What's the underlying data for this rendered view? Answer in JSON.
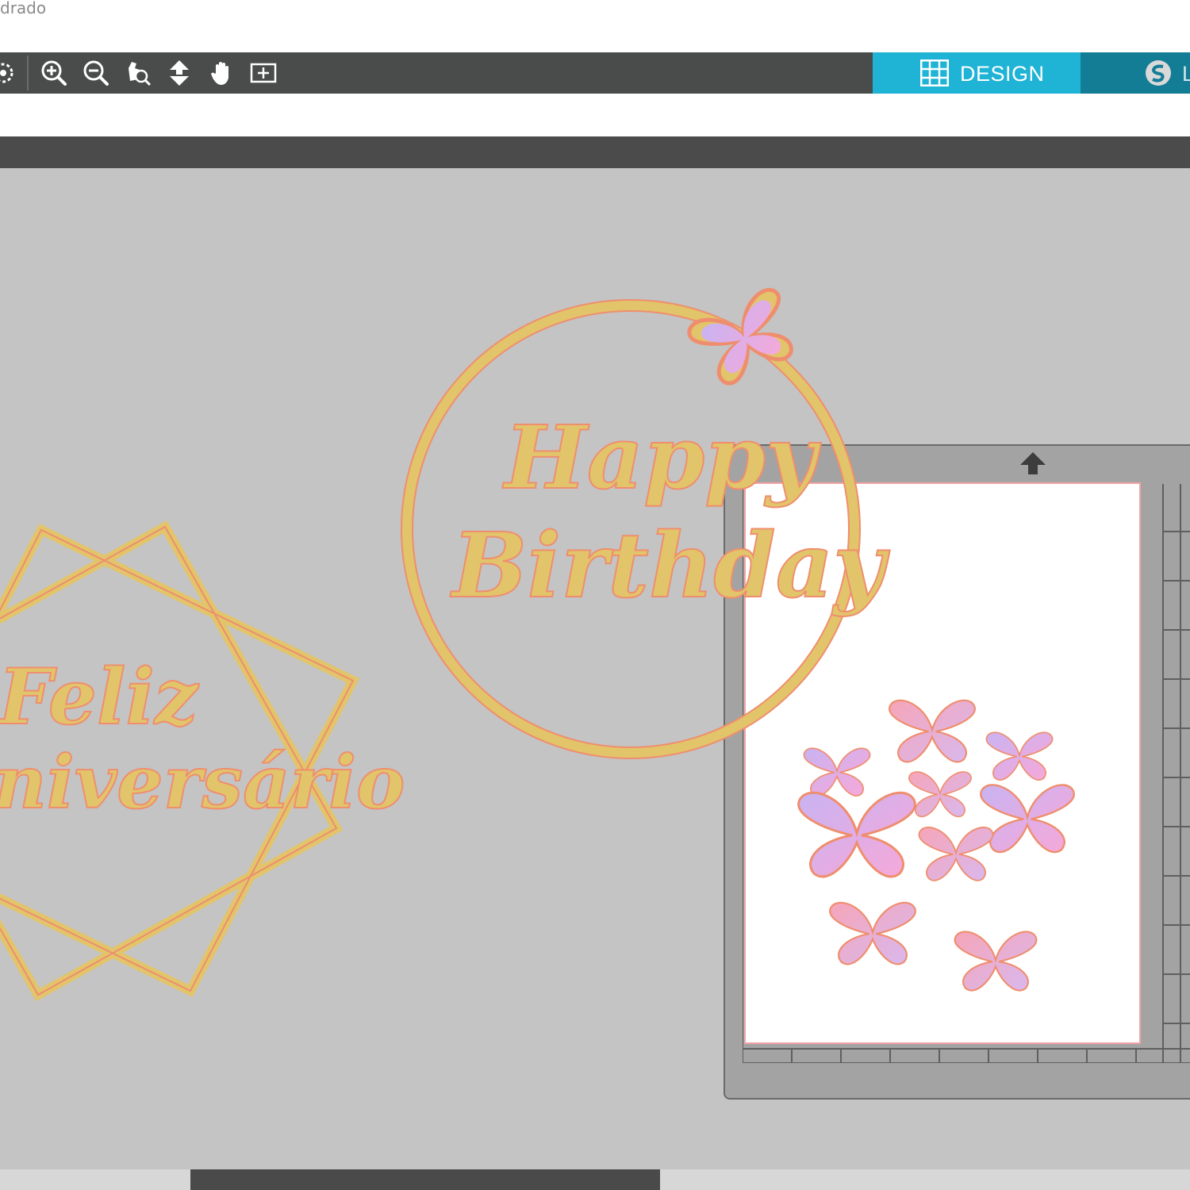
{
  "window": {
    "title": "drado"
  },
  "toolbar": {
    "tools": [
      {
        "name": "select-all-icon"
      },
      {
        "name": "zoom-in-icon"
      },
      {
        "name": "zoom-out-icon"
      },
      {
        "name": "zoom-to-selection-icon"
      },
      {
        "name": "drag-to-zoom-icon"
      },
      {
        "name": "pan-hand-icon"
      },
      {
        "name": "fit-to-page-icon"
      }
    ]
  },
  "tabs": {
    "design": {
      "label": "DESIGN",
      "icon": "grid-icon",
      "color": "#1fb3d6"
    },
    "next": {
      "label": "L",
      "icon": "silhouette-logo-icon",
      "color": "#137d96"
    }
  },
  "canvas": {
    "happy_birthday": {
      "line1": "Happy",
      "line2": "Birthday"
    },
    "feliz": {
      "line1": "Feliz",
      "line2": "niversário"
    },
    "gold_color": "#e2c46a",
    "outline_color": "#ef8e6e",
    "butterfly_colors": [
      "#f7a8d8",
      "#c9b3f2",
      "#f6a5b8"
    ]
  },
  "cutting_mat": {
    "arrow": "feed-arrow-icon",
    "butterfly_count": 10
  }
}
